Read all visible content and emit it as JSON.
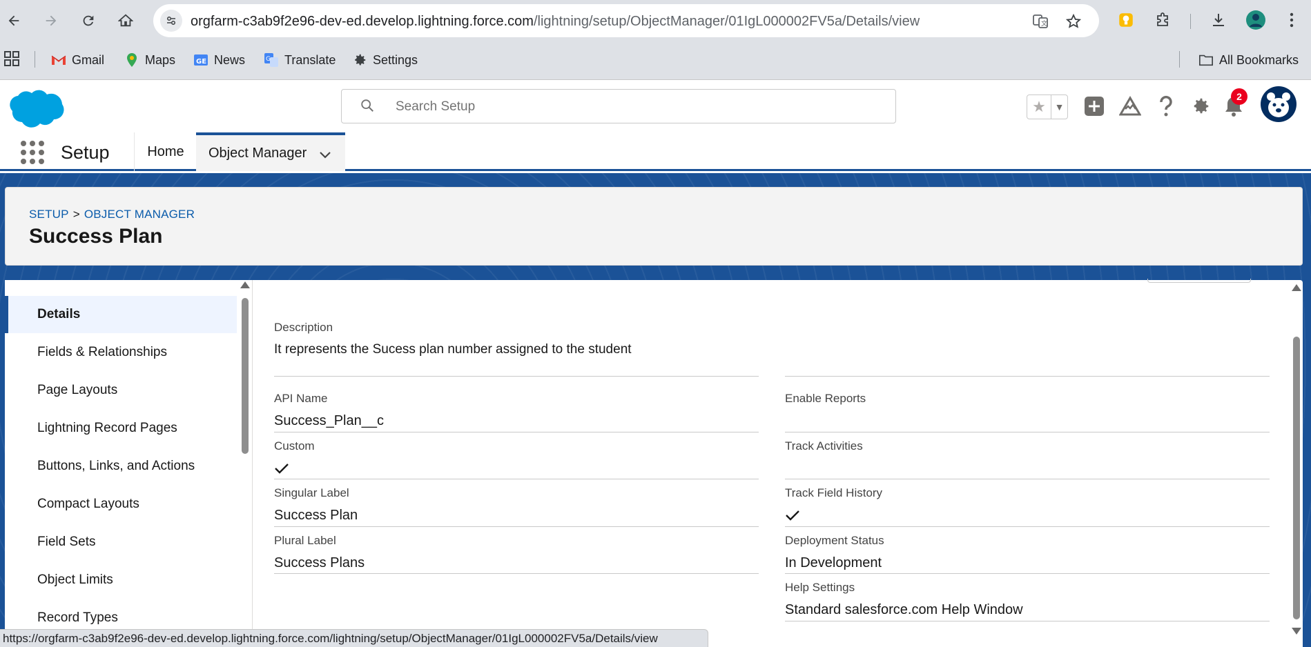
{
  "browser": {
    "url_domain": "orgfarm-c3ab9f2e96-dev-ed.develop.lightning.force.com",
    "url_path": "/lightning/setup/ObjectManager/01IgL000002FV5a/Details/view",
    "bookmarks": [
      {
        "label": "Gmail",
        "icon": "gmail-icon"
      },
      {
        "label": "Maps",
        "icon": "maps-icon"
      },
      {
        "label": "News",
        "icon": "news-icon"
      },
      {
        "label": "Translate",
        "icon": "translate-icon"
      },
      {
        "label": "Settings",
        "icon": "gear-icon"
      }
    ],
    "all_bookmarks": "All Bookmarks",
    "status_url": "https://orgfarm-c3ab9f2e96-dev-ed.develop.lightning.force.com/lightning/setup/ObjectManager/01IgL000002FV5a/Details/view"
  },
  "header": {
    "search_placeholder": "Search Setup",
    "notification_count": "2"
  },
  "appnav": {
    "app_name": "Setup",
    "tabs": [
      {
        "label": "Home"
      },
      {
        "label": "Object Manager"
      }
    ]
  },
  "page": {
    "breadcrumb": [
      "SETUP",
      "OBJECT MANAGER"
    ],
    "breadcrumb_separator": ">",
    "title": "Success Plan"
  },
  "leftnav": {
    "items": [
      {
        "label": "Details",
        "active": true
      },
      {
        "label": "Fields & Relationships"
      },
      {
        "label": "Page Layouts"
      },
      {
        "label": "Lightning Record Pages"
      },
      {
        "label": "Buttons, Links, and Actions"
      },
      {
        "label": "Compact Layouts"
      },
      {
        "label": "Field Sets"
      },
      {
        "label": "Object Limits"
      },
      {
        "label": "Record Types"
      }
    ]
  },
  "details": {
    "description": {
      "label": "Description",
      "value": "It represents the Sucess plan number assigned to the student"
    },
    "left": [
      {
        "label": "API Name",
        "value": "Success_Plan__c"
      },
      {
        "label": "Custom",
        "value": "",
        "checked": true
      },
      {
        "label": "Singular Label",
        "value": "Success Plan"
      },
      {
        "label": "Plural Label",
        "value": "Success Plans"
      }
    ],
    "right": [
      {
        "label": "Enable Reports",
        "value": ""
      },
      {
        "label": "Track Activities",
        "value": ""
      },
      {
        "label": "Track Field History",
        "value": "",
        "checked": true
      },
      {
        "label": "Deployment Status",
        "value": "In Development"
      },
      {
        "label": "Help Settings",
        "value": "Standard salesforce.com Help Window"
      }
    ]
  },
  "colors": {
    "brand_blue": "#1b5297",
    "link_blue": "#0b5cab",
    "salesforce_cloud": "#00a1e0",
    "badge_red": "#ea001e"
  }
}
